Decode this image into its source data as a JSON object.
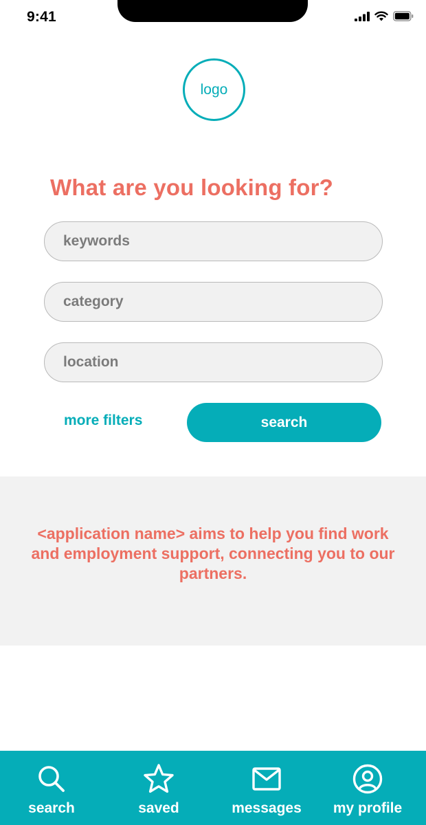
{
  "status_bar": {
    "time": "9:41"
  },
  "logo": {
    "text": "logo"
  },
  "search_form": {
    "heading": "What are you looking for?",
    "keywords_placeholder": "keywords",
    "category_placeholder": "category",
    "location_placeholder": "location",
    "more_filters_label": "more filters",
    "search_label": "search"
  },
  "info": {
    "text": "<application name> aims to help you find work and employment support, connecting you to our partners."
  },
  "tab_bar": {
    "items": [
      {
        "label": "search",
        "icon": "search-icon"
      },
      {
        "label": "saved",
        "icon": "star-icon"
      },
      {
        "label": "messages",
        "icon": "envelope-icon"
      },
      {
        "label": "my profile",
        "icon": "user-circle-icon"
      }
    ]
  },
  "colors": {
    "accent": "#05adb8",
    "headline": "#ec6f62",
    "field_bg": "#f1f1f1",
    "panel_bg": "#f2f2f2"
  }
}
